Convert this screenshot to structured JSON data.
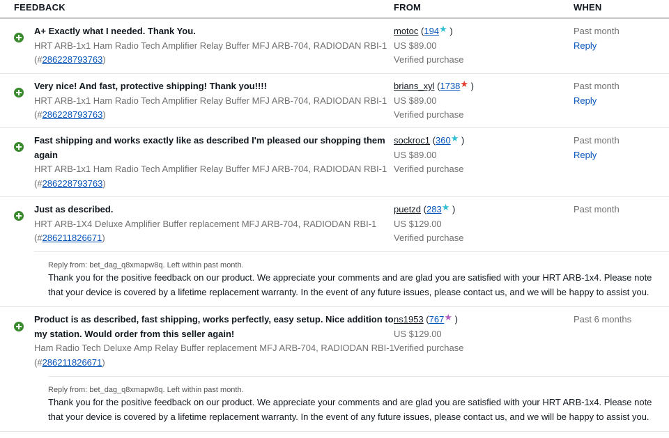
{
  "header": {
    "feedback": "FEEDBACK",
    "from": "FROM",
    "when": "WHEN"
  },
  "colors": {
    "positive": "#3a8a2e",
    "link": "#0654ba",
    "grey": "#707070",
    "star_teal": "#2fbfcf",
    "star_red": "#e03b2c",
    "star_purple": "#b35ec2"
  },
  "rows": [
    {
      "comment_lines": [
        "A+ Exactly what I needed. Thank You."
      ],
      "item_title": "HRT ARB-1x1 Ham Radio Tech Amplifier Relay Buffer MFJ ARB-704, RADIODAN RBI-1",
      "item_prefix": "(#",
      "item_number": "286228793763",
      "item_suffix": ")",
      "user": "motoc",
      "score_open": " (",
      "score": "194",
      "score_close": " )",
      "price": "US $89.00",
      "verified": "Verified purchase",
      "when": "Past month",
      "reply": "Reply",
      "star_icon": "teal-star-icon"
    },
    {
      "comment_lines": [
        "Very nice! And fast, protective shipping! Thank you!!!!"
      ],
      "item_title": "HRT ARB-1x1 Ham Radio Tech Amplifier Relay Buffer MFJ ARB-704, RADIODAN RBI-1",
      "item_prefix": "(#",
      "item_number": "286228793763",
      "item_suffix": ")",
      "user": "brians_xyl",
      "score_open": " (",
      "score": "1738",
      "score_close": " )",
      "price": "US $89.00",
      "verified": "Verified purchase",
      "when": "Past month",
      "reply": "Reply",
      "star_icon": "red-star-icon"
    },
    {
      "comment_lines": [
        "Fast shipping and works exactly like as described I'm pleased our shopping them",
        "again"
      ],
      "item_title": "HRT ARB-1x1 Ham Radio Tech Amplifier Relay Buffer MFJ ARB-704, RADIODAN RBI-1",
      "item_prefix": "(#",
      "item_number": "286228793763",
      "item_suffix": ")",
      "user": "sockroc1",
      "score_open": " (",
      "score": "360",
      "score_close": " )",
      "price": "US $89.00",
      "verified": "Verified purchase",
      "when": "Past month",
      "reply": "Reply",
      "star_icon": "teal-star-icon"
    },
    {
      "comment_lines": [
        "Just as described."
      ],
      "item_title": "HRT ARB-1X4 Deluxe Amplifier Buffer replacement MFJ ARB-704, RADIODAN RBI-1",
      "item_prefix": "(#",
      "item_number": "286211826671",
      "item_suffix": ")",
      "user": "puetzd",
      "score_open": " (",
      "score": "283",
      "score_close": " )",
      "price": "US $129.00",
      "verified": "Verified purchase",
      "when": "Past month",
      "star_icon": "teal-star-icon",
      "seller_reply": {
        "meta": "Reply from: bet_dag_q8xmapw8q. Left within past month.",
        "text": "Thank you for the positive feedback on our product. We appreciate your comments and are glad you are satisfied with your HRT ARB-1x4. Please note that your device is covered by a lifetime replacement warranty. In the event of any future issues, please contact us, and we will be happy to assist you."
      }
    },
    {
      "comment_lines": [
        "Product is as described, fast shipping, works perfectly, easy setup. Nice addition to",
        "my station. Would order from this seller again!"
      ],
      "item_title": "Ham Radio Tech Deluxe Amp Relay Buffer replacement MFJ ARB-704, RADIODAN RBI-1",
      "item_prefix": "(#",
      "item_number": "286211826671",
      "item_suffix": ")",
      "user": "ns1953",
      "score_open": " (",
      "score": "767",
      "score_close": " )",
      "price": "US $129.00",
      "verified": "Verified purchase",
      "when": "Past 6 months",
      "star_icon": "purple-star-icon",
      "seller_reply": {
        "meta": "Reply from: bet_dag_q8xmapw8q. Left within past month.",
        "text": "Thank you for the positive feedback on our product. We appreciate your comments and are glad you are satisfied with your HRT ARB-1x4. Please note that your device is covered by a lifetime replacement warranty. In the event of any future issues, please contact us, and we will be happy to assist you."
      }
    }
  ]
}
